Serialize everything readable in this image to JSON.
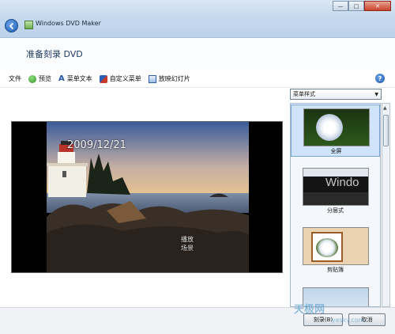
{
  "window": {
    "app_title": "Windows DVD Maker",
    "min_glyph": "—",
    "max_glyph": "□",
    "close_glyph": "✕"
  },
  "page": {
    "title": "准备刻录 DVD"
  },
  "toolbar": {
    "file": "文件",
    "preview": "预览",
    "menu_text": "菜单文本",
    "custom_menu": "自定义菜单",
    "slideshow": "放映幻灯片",
    "text_icon_glyph": "A",
    "help_glyph": "?"
  },
  "preview": {
    "date_title": "2009/12/21",
    "menu_play": "播放",
    "menu_scenes": "场景"
  },
  "styles": {
    "dropdown_label": "菜单样式",
    "items": [
      {
        "label": "全屏",
        "selected": true
      },
      {
        "label": "分层式",
        "selected": false
      },
      {
        "label": "剪贴簿",
        "selected": false
      },
      {
        "label": "",
        "selected": false
      }
    ],
    "thumb2_text": "Windo"
  },
  "footer": {
    "burn_button": "刻录(B)",
    "cancel_button": "取消"
  },
  "watermark": {
    "logo_text": "天极网",
    "url": "yesky.com"
  },
  "colors": {
    "title_text": "#1e3a66",
    "selected_style_bg": "#cfe4fa",
    "sky_top": "#3a5c9a",
    "sky_horizon": "#f3c98a"
  }
}
